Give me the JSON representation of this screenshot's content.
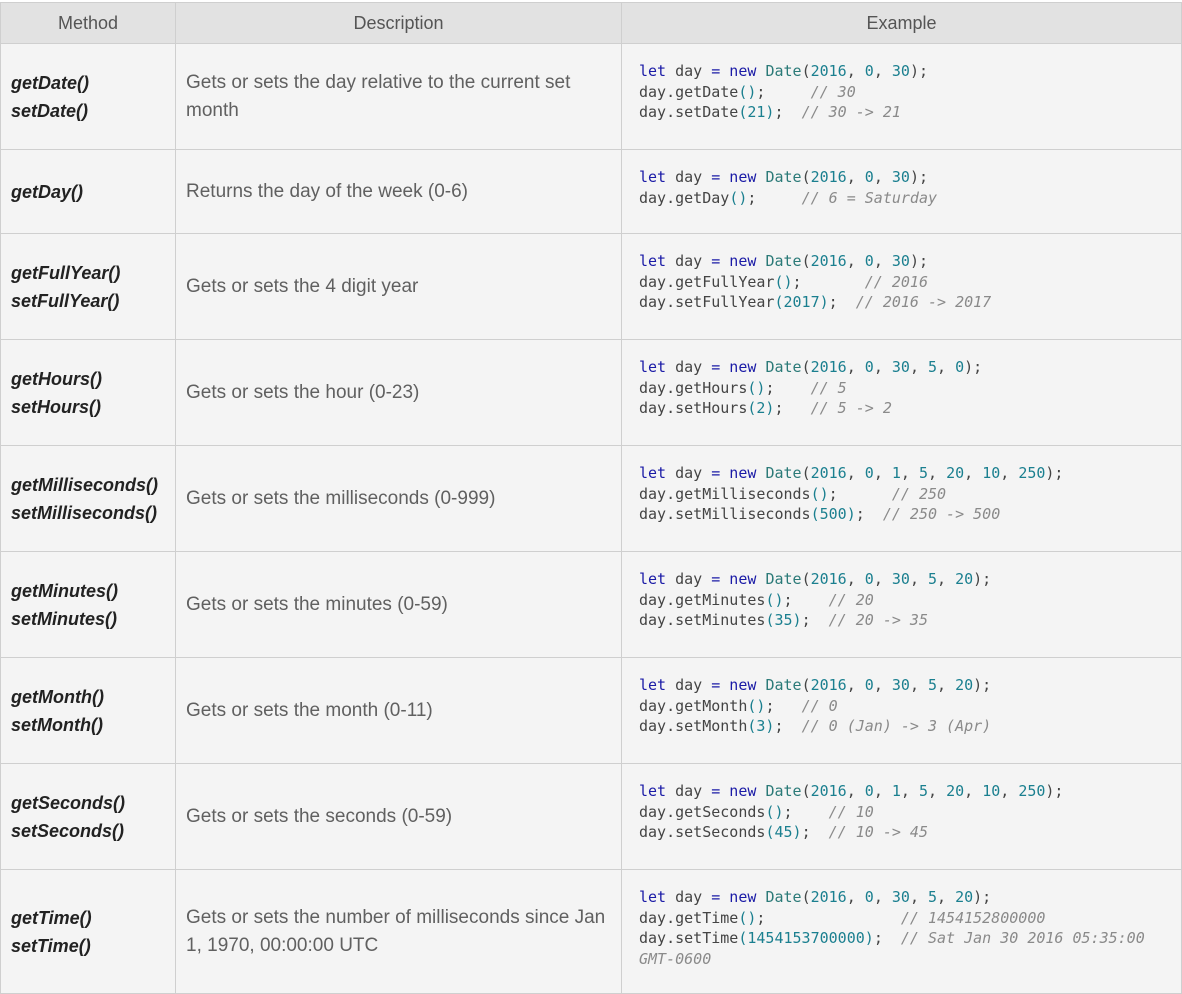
{
  "headers": {
    "method": "Method",
    "description": "Description",
    "example": "Example"
  },
  "rows": [
    {
      "methods": [
        "getDate()",
        "setDate()"
      ],
      "description": "Gets or sets the day relative to the current set month",
      "example": [
        [
          [
            "kw",
            "let"
          ],
          [
            "pun",
            " day "
          ],
          [
            "op",
            "="
          ],
          [
            "kw",
            " new "
          ],
          [
            "cls",
            "Date"
          ],
          [
            "pun",
            "("
          ],
          [
            "num",
            "2016"
          ],
          [
            "pun",
            ", "
          ],
          [
            "num",
            "0"
          ],
          [
            "pun",
            ", "
          ],
          [
            "num",
            "30"
          ],
          [
            "pun",
            ");"
          ]
        ],
        [
          [
            "pun",
            "day.getDate"
          ],
          [
            "num",
            "()"
          ],
          [
            "pun",
            ";     "
          ],
          [
            "cm",
            "// 30"
          ]
        ],
        [
          [
            "pun",
            "day.setDate"
          ],
          [
            "num",
            "(21)"
          ],
          [
            "pun",
            ";  "
          ],
          [
            "cm",
            "// 30 -> 21"
          ]
        ]
      ]
    },
    {
      "methods": [
        "getDay()"
      ],
      "description": "Returns the day of the week (0-6)",
      "example": [
        [
          [
            "kw",
            "let"
          ],
          [
            "pun",
            " day "
          ],
          [
            "op",
            "="
          ],
          [
            "kw",
            " new "
          ],
          [
            "cls",
            "Date"
          ],
          [
            "pun",
            "("
          ],
          [
            "num",
            "2016"
          ],
          [
            "pun",
            ", "
          ],
          [
            "num",
            "0"
          ],
          [
            "pun",
            ", "
          ],
          [
            "num",
            "30"
          ],
          [
            "pun",
            ");"
          ]
        ],
        [
          [
            "pun",
            "day.getDay"
          ],
          [
            "num",
            "()"
          ],
          [
            "pun",
            ";     "
          ],
          [
            "cm",
            "// 6 = Saturday"
          ]
        ]
      ]
    },
    {
      "methods": [
        "getFullYear()",
        "setFullYear()"
      ],
      "description": "Gets or sets the 4 digit year",
      "example": [
        [
          [
            "kw",
            "let"
          ],
          [
            "pun",
            " day "
          ],
          [
            "op",
            "="
          ],
          [
            "kw",
            " new "
          ],
          [
            "cls",
            "Date"
          ],
          [
            "pun",
            "("
          ],
          [
            "num",
            "2016"
          ],
          [
            "pun",
            ", "
          ],
          [
            "num",
            "0"
          ],
          [
            "pun",
            ", "
          ],
          [
            "num",
            "30"
          ],
          [
            "pun",
            ");"
          ]
        ],
        [
          [
            "pun",
            "day.getFullYear"
          ],
          [
            "num",
            "()"
          ],
          [
            "pun",
            ";       "
          ],
          [
            "cm",
            "// 2016"
          ]
        ],
        [
          [
            "pun",
            "day.setFullYear"
          ],
          [
            "num",
            "(2017)"
          ],
          [
            "pun",
            ";  "
          ],
          [
            "cm",
            "// 2016 -> 2017"
          ]
        ]
      ]
    },
    {
      "methods": [
        "getHours()",
        "setHours()"
      ],
      "description": "Gets or sets the hour (0-23)",
      "example": [
        [
          [
            "kw",
            "let"
          ],
          [
            "pun",
            " day "
          ],
          [
            "op",
            "="
          ],
          [
            "kw",
            " new "
          ],
          [
            "cls",
            "Date"
          ],
          [
            "pun",
            "("
          ],
          [
            "num",
            "2016"
          ],
          [
            "pun",
            ", "
          ],
          [
            "num",
            "0"
          ],
          [
            "pun",
            ", "
          ],
          [
            "num",
            "30"
          ],
          [
            "pun",
            ", "
          ],
          [
            "num",
            "5"
          ],
          [
            "pun",
            ", "
          ],
          [
            "num",
            "0"
          ],
          [
            "pun",
            ");"
          ]
        ],
        [
          [
            "pun",
            "day.getHours"
          ],
          [
            "num",
            "()"
          ],
          [
            "pun",
            ";    "
          ],
          [
            "cm",
            "// 5"
          ]
        ],
        [
          [
            "pun",
            "day.setHours"
          ],
          [
            "num",
            "(2)"
          ],
          [
            "pun",
            ";   "
          ],
          [
            "cm",
            "// 5 -> 2"
          ]
        ]
      ]
    },
    {
      "methods": [
        "getMilliseconds()",
        "setMilliseconds()"
      ],
      "description": "Gets or sets the milliseconds (0-999)",
      "example": [
        [
          [
            "kw",
            "let"
          ],
          [
            "pun",
            " day "
          ],
          [
            "op",
            "="
          ],
          [
            "kw",
            " new "
          ],
          [
            "cls",
            "Date"
          ],
          [
            "pun",
            "("
          ],
          [
            "num",
            "2016"
          ],
          [
            "pun",
            ", "
          ],
          [
            "num",
            "0"
          ],
          [
            "pun",
            ", "
          ],
          [
            "num",
            "1"
          ],
          [
            "pun",
            ", "
          ],
          [
            "num",
            "5"
          ],
          [
            "pun",
            ", "
          ],
          [
            "num",
            "20"
          ],
          [
            "pun",
            ", "
          ],
          [
            "num",
            "10"
          ],
          [
            "pun",
            ", "
          ],
          [
            "num",
            "250"
          ],
          [
            "pun",
            ");"
          ]
        ],
        [
          [
            "pun",
            "day.getMilliseconds"
          ],
          [
            "num",
            "()"
          ],
          [
            "pun",
            ";      "
          ],
          [
            "cm",
            "// 250"
          ]
        ],
        [
          [
            "pun",
            "day.setMilliseconds"
          ],
          [
            "num",
            "(500)"
          ],
          [
            "pun",
            ";  "
          ],
          [
            "cm",
            "// 250 -> 500"
          ]
        ]
      ]
    },
    {
      "methods": [
        "getMinutes()",
        "setMinutes()"
      ],
      "description": "Gets or sets the minutes (0-59)",
      "example": [
        [
          [
            "kw",
            "let"
          ],
          [
            "pun",
            " day "
          ],
          [
            "op",
            "="
          ],
          [
            "kw",
            " new "
          ],
          [
            "cls",
            "Date"
          ],
          [
            "pun",
            "("
          ],
          [
            "num",
            "2016"
          ],
          [
            "pun",
            ", "
          ],
          [
            "num",
            "0"
          ],
          [
            "pun",
            ", "
          ],
          [
            "num",
            "30"
          ],
          [
            "pun",
            ", "
          ],
          [
            "num",
            "5"
          ],
          [
            "pun",
            ", "
          ],
          [
            "num",
            "20"
          ],
          [
            "pun",
            ");"
          ]
        ],
        [
          [
            "pun",
            "day.getMinutes"
          ],
          [
            "num",
            "()"
          ],
          [
            "pun",
            ";    "
          ],
          [
            "cm",
            "// 20"
          ]
        ],
        [
          [
            "pun",
            "day.setMinutes"
          ],
          [
            "num",
            "(35)"
          ],
          [
            "pun",
            ";  "
          ],
          [
            "cm",
            "// 20 -> 35"
          ]
        ]
      ]
    },
    {
      "methods": [
        "getMonth()",
        "setMonth()"
      ],
      "description": "Gets or sets the month (0-11)",
      "example": [
        [
          [
            "kw",
            "let"
          ],
          [
            "pun",
            " day "
          ],
          [
            "op",
            "="
          ],
          [
            "kw",
            " new "
          ],
          [
            "cls",
            "Date"
          ],
          [
            "pun",
            "("
          ],
          [
            "num",
            "2016"
          ],
          [
            "pun",
            ", "
          ],
          [
            "num",
            "0"
          ],
          [
            "pun",
            ", "
          ],
          [
            "num",
            "30"
          ],
          [
            "pun",
            ", "
          ],
          [
            "num",
            "5"
          ],
          [
            "pun",
            ", "
          ],
          [
            "num",
            "20"
          ],
          [
            "pun",
            ");"
          ]
        ],
        [
          [
            "pun",
            "day.getMonth"
          ],
          [
            "num",
            "()"
          ],
          [
            "pun",
            ";   "
          ],
          [
            "cm",
            "// 0"
          ]
        ],
        [
          [
            "pun",
            "day.setMonth"
          ],
          [
            "num",
            "(3)"
          ],
          [
            "pun",
            ";  "
          ],
          [
            "cm",
            "// 0 (Jan) -> 3 (Apr)"
          ]
        ]
      ]
    },
    {
      "methods": [
        "getSeconds()",
        "setSeconds()"
      ],
      "description": "Gets or sets the seconds (0-59)",
      "example": [
        [
          [
            "kw",
            "let"
          ],
          [
            "pun",
            " day "
          ],
          [
            "op",
            "="
          ],
          [
            "kw",
            " new "
          ],
          [
            "cls",
            "Date"
          ],
          [
            "pun",
            "("
          ],
          [
            "num",
            "2016"
          ],
          [
            "pun",
            ", "
          ],
          [
            "num",
            "0"
          ],
          [
            "pun",
            ", "
          ],
          [
            "num",
            "1"
          ],
          [
            "pun",
            ", "
          ],
          [
            "num",
            "5"
          ],
          [
            "pun",
            ", "
          ],
          [
            "num",
            "20"
          ],
          [
            "pun",
            ", "
          ],
          [
            "num",
            "10"
          ],
          [
            "pun",
            ", "
          ],
          [
            "num",
            "250"
          ],
          [
            "pun",
            ");"
          ]
        ],
        [
          [
            "pun",
            "day.getSeconds"
          ],
          [
            "num",
            "()"
          ],
          [
            "pun",
            ";    "
          ],
          [
            "cm",
            "// 10"
          ]
        ],
        [
          [
            "pun",
            "day.setSeconds"
          ],
          [
            "num",
            "(45)"
          ],
          [
            "pun",
            ";  "
          ],
          [
            "cm",
            "// 10 -> 45"
          ]
        ]
      ]
    },
    {
      "methods": [
        "getTime()",
        "setTime()"
      ],
      "description": "Gets or sets the number of milliseconds since Jan 1, 1970, 00:00:00 UTC",
      "example": [
        [
          [
            "kw",
            "let"
          ],
          [
            "pun",
            " day "
          ],
          [
            "op",
            "="
          ],
          [
            "kw",
            " new "
          ],
          [
            "cls",
            "Date"
          ],
          [
            "pun",
            "("
          ],
          [
            "num",
            "2016"
          ],
          [
            "pun",
            ", "
          ],
          [
            "num",
            "0"
          ],
          [
            "pun",
            ", "
          ],
          [
            "num",
            "30"
          ],
          [
            "pun",
            ", "
          ],
          [
            "num",
            "5"
          ],
          [
            "pun",
            ", "
          ],
          [
            "num",
            "20"
          ],
          [
            "pun",
            ");"
          ]
        ],
        [
          [
            "pun",
            "day.getTime"
          ],
          [
            "num",
            "()"
          ],
          [
            "pun",
            ";               "
          ],
          [
            "cm",
            "// 1454152800000"
          ]
        ],
        [
          [
            "pun",
            "day.setTime"
          ],
          [
            "num",
            "(1454153700000)"
          ],
          [
            "pun",
            ";  "
          ],
          [
            "cm",
            "// Sat Jan 30 2016 05:35:00 GMT-0600"
          ]
        ]
      ]
    }
  ]
}
